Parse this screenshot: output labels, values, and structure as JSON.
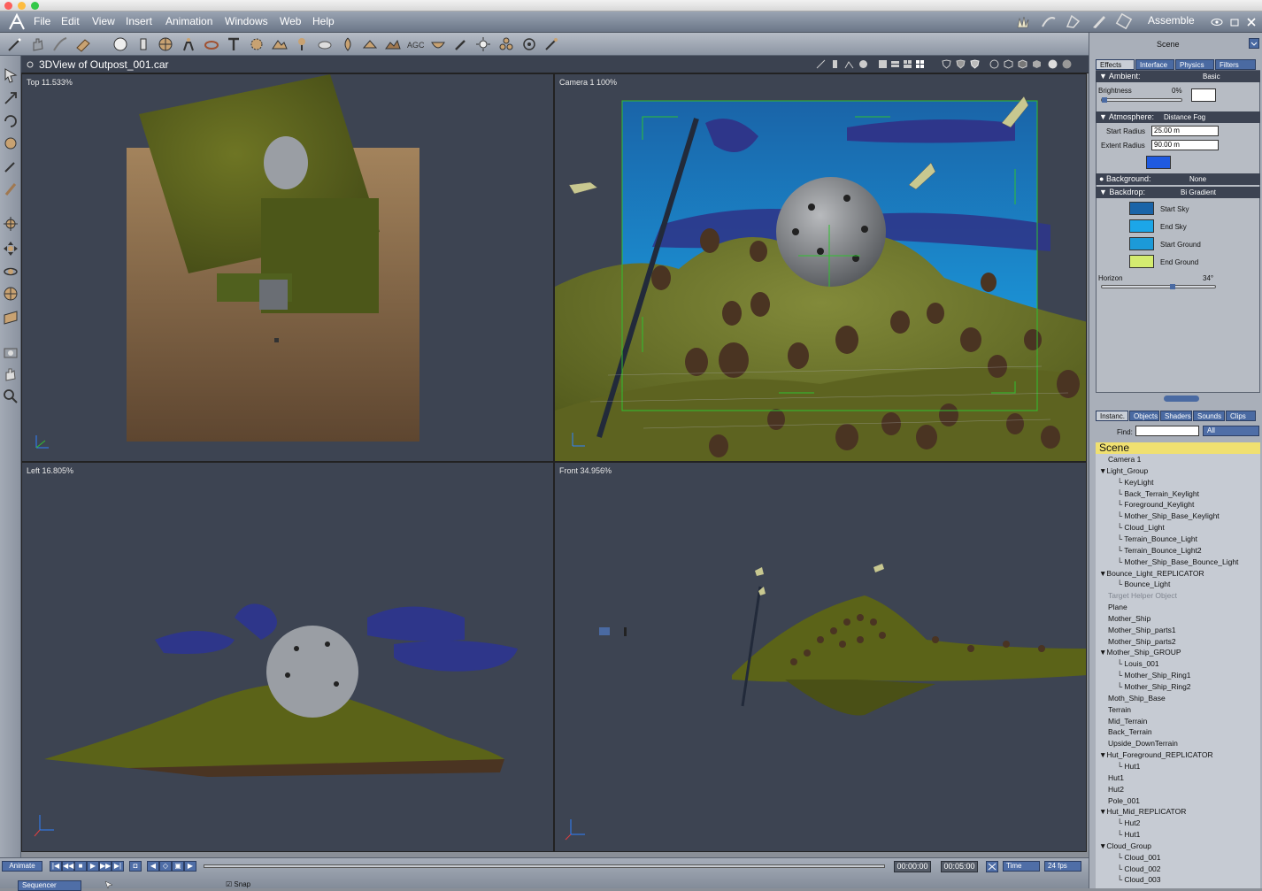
{
  "menu": {
    "items": [
      "File",
      "Edit",
      "View",
      "Insert",
      "Animation",
      "Windows",
      "Web",
      "Help"
    ],
    "room_title": "Assemble"
  },
  "document": {
    "title": "3DView of Outpost_001.car"
  },
  "viewports": {
    "top_label": "Top 11.533%",
    "camera_label": "Camera 1 100%",
    "left_label": "Left 16.805%",
    "front_label": "Front 34.956%"
  },
  "panel": {
    "title": "Scene",
    "tabs": [
      "Effects",
      "Interface",
      "Physics",
      "Filters"
    ],
    "ambient": {
      "label": "Ambient:",
      "value": "Basic",
      "brightness_label": "Brightness",
      "brightness_value": "0%",
      "brightness_level": 0
    },
    "atmosphere": {
      "label": "Atmosphere:",
      "value": "Distance Fog",
      "start_radius_label": "Start Radius",
      "start_radius": "25.00 m",
      "extent_radius_label": "Extent Radius",
      "extent_radius": "90.00 m"
    },
    "background": {
      "label": "Background:",
      "value": "None"
    },
    "backdrop": {
      "label": "Backdrop:",
      "value": "Bi Gradient",
      "swatches": [
        {
          "label": "Start Sky",
          "color": "#1a64a8"
        },
        {
          "label": "End Sky",
          "color": "#1ca6e8"
        },
        {
          "label": "Start Ground",
          "color": "#1c9ad8"
        },
        {
          "label": "End Ground",
          "color": "#d4ec70"
        }
      ],
      "horizon_label": "Horizon",
      "horizon_value": "34°",
      "horizon_level": 0.62
    },
    "fog_color": "#1f5ae0"
  },
  "instances": {
    "tabs": [
      "Instanc.",
      "Objects",
      "Shaders",
      "Sounds",
      "Clips"
    ],
    "find_label": "Find:",
    "find_value": "",
    "filter_value": "All",
    "tree": [
      {
        "label": "Scene",
        "level": 0,
        "selected": true
      },
      {
        "label": "Camera 1",
        "level": 1
      },
      {
        "label": "Light_Group",
        "level": 0,
        "expanded": true
      },
      {
        "label": "KeyLight",
        "level": 2
      },
      {
        "label": "Back_Terrain_Keylight",
        "level": 2
      },
      {
        "label": "Foreground_Keylight",
        "level": 2
      },
      {
        "label": "Mother_Ship_Base_Keylight",
        "level": 2
      },
      {
        "label": "Cloud_Light",
        "level": 2
      },
      {
        "label": "Terrain_Bounce_Light",
        "level": 2
      },
      {
        "label": "Terrain_Bounce_Light2",
        "level": 2
      },
      {
        "label": "Mother_Ship_Base_Bounce_Light",
        "level": 2
      },
      {
        "label": "Bounce_Light_REPLICATOR",
        "level": 0,
        "expanded": true
      },
      {
        "label": "Bounce_Light",
        "level": 2
      },
      {
        "label": "Target Helper Object",
        "level": 1,
        "dim": true
      },
      {
        "label": "Plane",
        "level": 1
      },
      {
        "label": "Mother_Ship",
        "level": 1
      },
      {
        "label": "Mother_Ship_parts1",
        "level": 1
      },
      {
        "label": "Mother_Ship_parts2",
        "level": 1
      },
      {
        "label": "Mother_Ship_GROUP",
        "level": 0,
        "expanded": true
      },
      {
        "label": "Louis_001",
        "level": 2
      },
      {
        "label": "Mother_Ship_Ring1",
        "level": 2
      },
      {
        "label": "Mother_Ship_Ring2",
        "level": 2
      },
      {
        "label": "Moth_Ship_Base",
        "level": 1
      },
      {
        "label": "Terrain",
        "level": 1
      },
      {
        "label": "Mid_Terrain",
        "level": 1
      },
      {
        "label": "Back_Terrain",
        "level": 1
      },
      {
        "label": "Upside_DownTerrain",
        "level": 1
      },
      {
        "label": "Hut_Foreground_REPLICATOR",
        "level": 0,
        "expanded": true
      },
      {
        "label": "Hut1",
        "level": 2
      },
      {
        "label": "Hut1",
        "level": 1
      },
      {
        "label": "Hut2",
        "level": 1
      },
      {
        "label": "Pole_001",
        "level": 1
      },
      {
        "label": "Hut_Mid_REPLICATOR",
        "level": 0,
        "expanded": true
      },
      {
        "label": "Hut2",
        "level": 2
      },
      {
        "label": "Hut1",
        "level": 2
      },
      {
        "label": "Cloud_Group",
        "level": 0,
        "expanded": true
      },
      {
        "label": "Cloud_001",
        "level": 2
      },
      {
        "label": "Cloud_002",
        "level": 2
      },
      {
        "label": "Cloud_003",
        "level": 2
      }
    ]
  },
  "timeline": {
    "mode": "Animate",
    "current_time": "00:00:00",
    "end_time": "00:05:00",
    "time_unit": "Time",
    "fps": "24 fps",
    "sequencer": "Sequencer",
    "snap_label": "Snap"
  },
  "colors": {
    "accent": "#4a6aa2",
    "viewport_bg": "#3d4452",
    "scene_highlight": "#f0e070"
  }
}
